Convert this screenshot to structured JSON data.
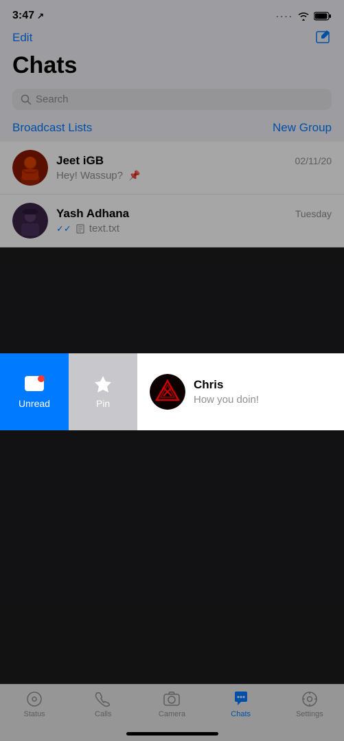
{
  "statusBar": {
    "time": "3:47",
    "locationIcon": "↗"
  },
  "header": {
    "editLabel": "Edit",
    "title": "Chats"
  },
  "search": {
    "placeholder": "Search"
  },
  "links": {
    "broadcastLists": "Broadcast Lists",
    "newGroup": "New Group"
  },
  "chats": [
    {
      "id": "jeet",
      "name": "Jeet iGB",
      "preview": "Hey! Wassup?",
      "time": "02/11/20",
      "pinned": true
    },
    {
      "id": "yash",
      "name": "Yash Adhana",
      "preview": "text.txt",
      "time": "Tuesday",
      "doubleCheck": true,
      "fileIcon": true
    },
    {
      "id": "chris",
      "name": "Chris",
      "preview": "How you doin!",
      "time": "",
      "swipeRevealed": true
    }
  ],
  "swipeActions": [
    {
      "id": "unread",
      "label": "Unread",
      "icon": "chat-unread-icon"
    },
    {
      "id": "pin",
      "label": "Pin",
      "icon": "pin-icon"
    }
  ],
  "tabBar": {
    "tabs": [
      {
        "id": "status",
        "label": "Status",
        "icon": "⊙",
        "active": false
      },
      {
        "id": "calls",
        "label": "Calls",
        "icon": "✆",
        "active": false
      },
      {
        "id": "camera",
        "label": "Camera",
        "icon": "⊡",
        "active": false
      },
      {
        "id": "chats",
        "label": "Chats",
        "icon": "💬",
        "active": true
      },
      {
        "id": "settings",
        "label": "Settings",
        "icon": "⚙",
        "active": false
      }
    ]
  },
  "colors": {
    "accent": "#007aff",
    "unreadAction": "#007aff",
    "pinAction": "#c7c7cc"
  }
}
